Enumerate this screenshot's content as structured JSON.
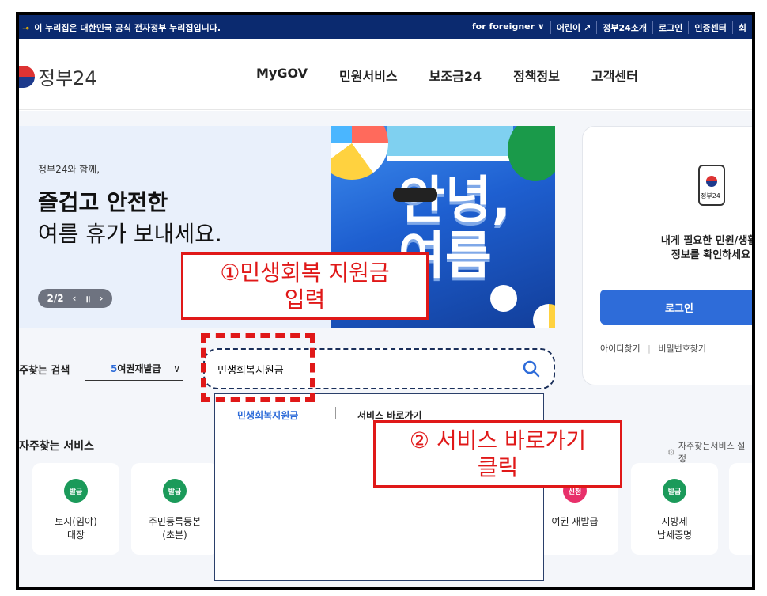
{
  "govbar": {
    "notice": "이 누리집은 대한민국 공식 전자정부 누리집입니다.",
    "links": [
      "for foreigner ∨",
      "어린이 ↗",
      "정부24소개",
      "로그인",
      "인증센터",
      "회"
    ]
  },
  "header": {
    "logo_text": "정부24",
    "nav": [
      "MyGOV",
      "민원서비스",
      "보조금24",
      "정책정보",
      "고객센터"
    ]
  },
  "banner": {
    "small": "정부24와 함께,",
    "line1": "즐겁고 안전한",
    "line2": "여름 휴가 보내세요.",
    "pager": "2/2",
    "pager_prev": "‹",
    "pager_pause": "॥",
    "pager_next": "›",
    "image_text": "안녕,\n여름"
  },
  "login": {
    "phone_label": "정부24",
    "message": "내게 필요한 민원/생활/\n정보를 확인하세요",
    "button": "로그인",
    "link_id": "아이디찾기",
    "link_pw": "비밀번호찾기"
  },
  "search": {
    "label": "주찾는 검색",
    "select_num": "5",
    "select_text": "여권재발급",
    "query": "민생회복지원금",
    "suggest_item": "민생회복지원금",
    "suggest_action": "서비스 바로가기"
  },
  "freq": {
    "title": "자주찾는 서비스",
    "settings": "자주찾는서비스 설정",
    "cards": [
      {
        "badge": "발급",
        "name": "토지(임야)\n대장"
      },
      {
        "badge": "발급",
        "name": "주민등록등본\n(초본)"
      },
      {
        "badge": "신청",
        "name": "여권 재발급"
      },
      {
        "badge": "발급",
        "name": "지방세\n납세증명"
      }
    ]
  },
  "annotations": {
    "step1": "①민생회복 지원금\n입력",
    "step2": "② 서비스 바로가기\n클릭"
  },
  "colors": {
    "govbar": "#0b2a6f",
    "accent": "#2e6cd9",
    "annotation": "#e01818",
    "badge_green": "#1b9a5a",
    "badge_pink": "#e8306a"
  }
}
